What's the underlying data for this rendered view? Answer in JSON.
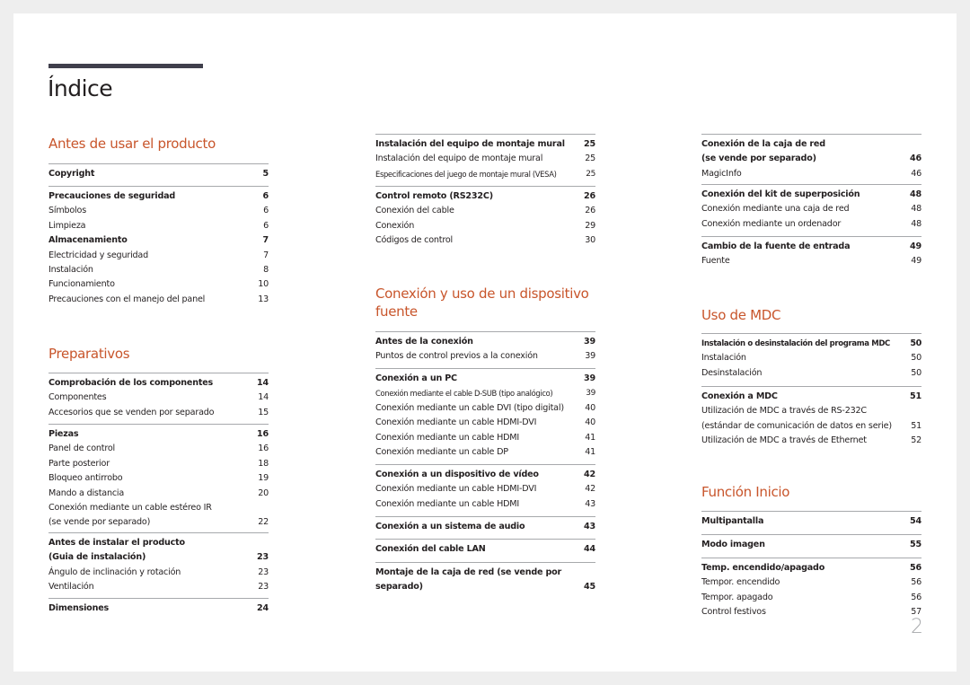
{
  "page_title": "Índice",
  "page_number": "2",
  "columns": [
    {
      "sections": [
        {
          "heading": "Antes de usar el producto",
          "groups": [
            {
              "entries": [
                {
                  "label": "Copyright",
                  "page": "5",
                  "main": true
                }
              ]
            },
            {
              "entries": [
                {
                  "label": "Precauciones de seguridad",
                  "page": "6",
                  "main": true
                },
                {
                  "label": "Símbolos",
                  "page": "6"
                },
                {
                  "label": "Limpieza",
                  "page": "6"
                },
                {
                  "label": "Almacenamiento",
                  "page": "7",
                  "main": true
                },
                {
                  "label": "Electricidad y seguridad",
                  "page": "7"
                },
                {
                  "label": "Instalación",
                  "page": "8"
                },
                {
                  "label": "Funcionamiento",
                  "page": "10"
                },
                {
                  "label": "Precauciones con el manejo del panel",
                  "page": "13"
                }
              ]
            }
          ]
        },
        {
          "heading": "Preparativos",
          "groups": [
            {
              "entries": [
                {
                  "label": "Comprobación de los componentes",
                  "page": "14",
                  "main": true
                },
                {
                  "label": "Componentes",
                  "page": "14"
                },
                {
                  "label": "Accesorios que se venden por separado",
                  "page": "15"
                }
              ]
            },
            {
              "entries": [
                {
                  "label": "Piezas",
                  "page": "16",
                  "main": true
                },
                {
                  "label": "Panel de control",
                  "page": "16"
                },
                {
                  "label": "Parte posterior",
                  "page": "18"
                },
                {
                  "label": "Bloqueo antirrobo",
                  "page": "19"
                },
                {
                  "label": "Mando a distancia",
                  "page": "20"
                },
                {
                  "label": "Conexión mediante un cable estéreo IR",
                  "page": ""
                },
                {
                  "label": "(se vende por separado)",
                  "page": "22"
                }
              ]
            },
            {
              "entries": [
                {
                  "label": "Antes de instalar el producto",
                  "page": "",
                  "main": true
                },
                {
                  "label": "(Guia de instalación)",
                  "page": "23",
                  "main": true
                },
                {
                  "label": "Ángulo de inclinación y rotación",
                  "page": "23"
                },
                {
                  "label": "Ventilación",
                  "page": "23"
                }
              ]
            },
            {
              "entries": [
                {
                  "label": "Dimensiones",
                  "page": "24",
                  "main": true
                }
              ]
            }
          ]
        }
      ]
    },
    {
      "sections": [
        {
          "heading": "",
          "groups": [
            {
              "entries": [
                {
                  "label": "Instalación del equipo de montaje mural",
                  "page": "25",
                  "main": true
                },
                {
                  "label": "Instalación del equipo de montaje mural",
                  "page": "25"
                },
                {
                  "label": "Especificaciones del juego de montaje mural (VESA)",
                  "page": "25",
                  "small": true
                }
              ]
            },
            {
              "entries": [
                {
                  "label": "Control remoto (RS232C)",
                  "page": "26",
                  "main": true
                },
                {
                  "label": "Conexión del cable",
                  "page": "26"
                },
                {
                  "label": "Conexión",
                  "page": "29"
                },
                {
                  "label": "Códigos de control",
                  "page": "30"
                }
              ]
            }
          ]
        },
        {
          "heading": "Conexión y uso de un dispositivo fuente",
          "groups": [
            {
              "entries": [
                {
                  "label": "Antes de la conexión",
                  "page": "39",
                  "main": true
                },
                {
                  "label": "Puntos de control previos a la conexión",
                  "page": "39"
                }
              ]
            },
            {
              "entries": [
                {
                  "label": "Conexión a un PC",
                  "page": "39",
                  "main": true
                },
                {
                  "label": "Conexión mediante el cable D-SUB (tipo analógico)",
                  "page": "39",
                  "small": true
                },
                {
                  "label": "Conexión mediante un cable DVI (tipo digital)",
                  "page": "40"
                },
                {
                  "label": "Conexión mediante un cable HDMI-DVI",
                  "page": "40"
                },
                {
                  "label": "Conexión mediante un cable HDMI",
                  "page": "41"
                },
                {
                  "label": "Conexión mediante un cable DP",
                  "page": "41"
                }
              ]
            },
            {
              "entries": [
                {
                  "label": "Conexión a un dispositivo de vídeo",
                  "page": "42",
                  "main": true
                },
                {
                  "label": "Conexión mediante un cable HDMI-DVI",
                  "page": "42"
                },
                {
                  "label": "Conexión mediante un cable HDMI",
                  "page": "43"
                }
              ]
            },
            {
              "entries": [
                {
                  "label": "Conexión a un sistema de audio",
                  "page": "43",
                  "main": true
                }
              ]
            },
            {
              "entries": [
                {
                  "label": "Conexión del cable LAN",
                  "page": "44",
                  "main": true
                }
              ]
            },
            {
              "entries": [
                {
                  "label": "Montaje de la caja de red (se vende por",
                  "page": "",
                  "main": true
                },
                {
                  "label": "separado)",
                  "page": "45",
                  "main": true
                }
              ]
            }
          ]
        }
      ]
    },
    {
      "sections": [
        {
          "heading": "",
          "groups": [
            {
              "entries": [
                {
                  "label": "Conexión de la caja de red",
                  "page": "",
                  "main": true
                },
                {
                  "label": "(se vende por separado)",
                  "page": "46",
                  "main": true
                },
                {
                  "label": "MagicInfo",
                  "page": "46"
                }
              ]
            },
            {
              "entries": [
                {
                  "label": "Conexión del kit de superposición",
                  "page": "48",
                  "main": true
                },
                {
                  "label": "Conexión mediante una caja de red",
                  "page": "48"
                },
                {
                  "label": "Conexión mediante un ordenador",
                  "page": "48"
                }
              ]
            },
            {
              "entries": [
                {
                  "label": "Cambio de la fuente de entrada",
                  "page": "49",
                  "main": true
                },
                {
                  "label": "Fuente",
                  "page": "49"
                }
              ]
            }
          ]
        },
        {
          "heading": "Uso de MDC",
          "groups": [
            {
              "entries": [
                {
                  "label": "Instalación o desinstalación del programa MDC",
                  "page": "50",
                  "main": true,
                  "tiny": true
                },
                {
                  "label": "Instalación",
                  "page": "50"
                },
                {
                  "label": "Desinstalación",
                  "page": "50"
                }
              ]
            },
            {
              "entries": [
                {
                  "label": "Conexión a MDC",
                  "page": "51",
                  "main": true
                },
                {
                  "label": "Utilización de MDC a través de RS-232C",
                  "page": ""
                },
                {
                  "label": "(estándar de comunicación de datos en serie)",
                  "page": "51"
                },
                {
                  "label": "Utilización de MDC a través de Ethernet",
                  "page": "52"
                }
              ]
            }
          ]
        },
        {
          "heading": "Función Inicio",
          "groups": [
            {
              "entries": [
                {
                  "label": "Multipantalla",
                  "page": "54",
                  "main": true
                }
              ]
            },
            {
              "entries": [
                {
                  "label": "Modo imagen",
                  "page": "55",
                  "main": true
                }
              ]
            },
            {
              "entries": [
                {
                  "label": "Temp. encendido/apagado",
                  "page": "56",
                  "main": true
                },
                {
                  "label": "Tempor. encendido",
                  "page": "56"
                },
                {
                  "label": "Tempor. apagado",
                  "page": "56"
                },
                {
                  "label": "Control festivos",
                  "page": "57"
                }
              ]
            }
          ]
        }
      ]
    }
  ]
}
